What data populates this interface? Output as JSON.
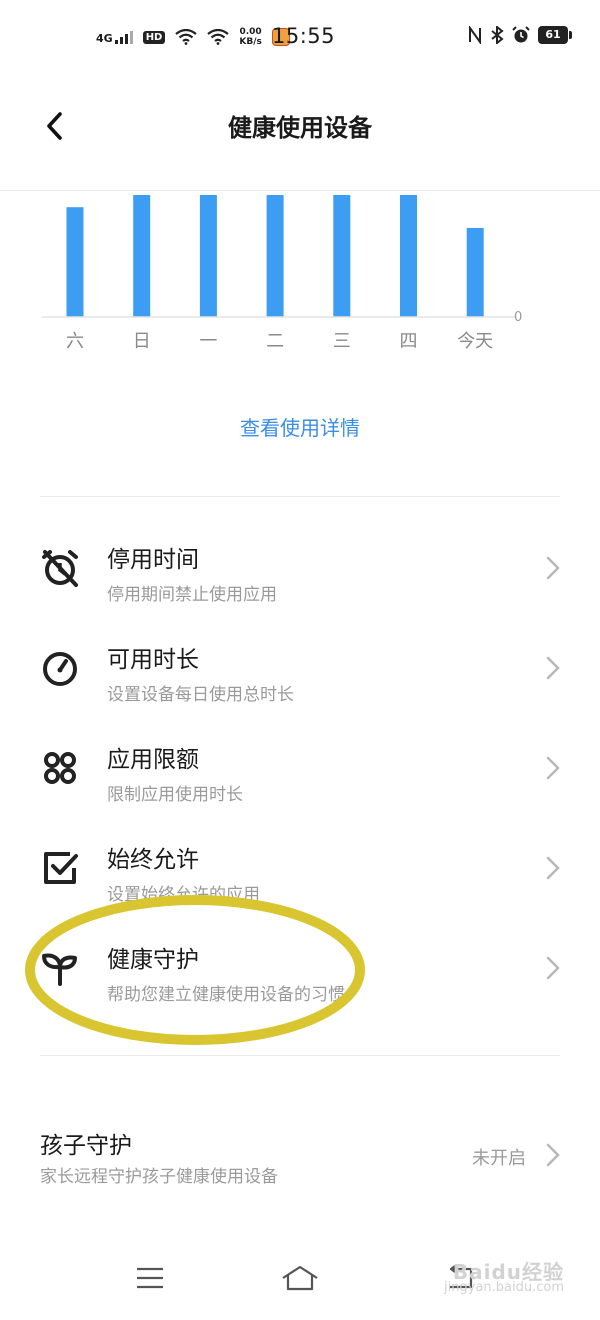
{
  "status_bar": {
    "network": "4G",
    "hd": "HD",
    "speed_value": "0.00",
    "speed_unit": "KB/s",
    "time": "15:55",
    "battery": "61"
  },
  "header": {
    "title": "健康使用设备"
  },
  "chart_data": {
    "type": "bar",
    "categories": [
      "六",
      "日",
      "一",
      "二",
      "三",
      "四",
      "今天"
    ],
    "values": [
      0.9,
      1.0,
      1.0,
      1.0,
      1.0,
      1.0,
      0.73
    ],
    "zero_label": "0",
    "bar_color": "#3d9df2"
  },
  "usage_link": "查看使用详情",
  "menu": [
    {
      "icon": "alarm-off-icon",
      "title": "停用时间",
      "subtitle": "停用期间禁止使用应用"
    },
    {
      "icon": "gauge-icon",
      "title": "可用时长",
      "subtitle": "设置设备每日使用总时长"
    },
    {
      "icon": "app-grid-icon",
      "title": "应用限额",
      "subtitle": "限制应用使用时长"
    },
    {
      "icon": "checkbox-icon",
      "title": "始终允许",
      "subtitle": "设置始终允许的应用"
    },
    {
      "icon": "sprout-icon",
      "title": "健康守护",
      "subtitle": "帮助您建立健康使用设备的习惯"
    }
  ],
  "kid_guard": {
    "title": "孩子守护",
    "subtitle": "家长远程守护孩子健康使用设备",
    "status": "未开启"
  },
  "annotation_color": "#d8c52f",
  "watermark": {
    "logo": "Baidu经验",
    "url": "jingyan.baidu.com"
  }
}
